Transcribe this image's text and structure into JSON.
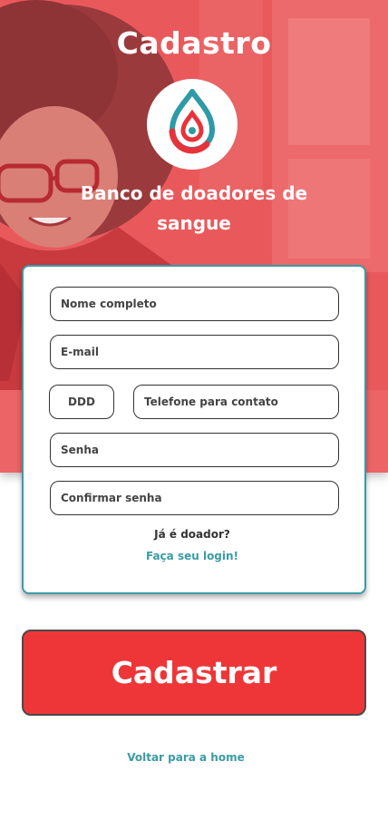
{
  "header": {
    "title": "Cadastro",
    "subtitle": "Banco de doadores de sangue",
    "logo_icon": "blood-drop-icon"
  },
  "form": {
    "full_name_placeholder": "Nome completo",
    "email_placeholder": "E-mail",
    "ddd_placeholder": "DDD",
    "phone_placeholder": "Telefone para contato",
    "password_placeholder": "Senha",
    "confirm_password_placeholder": "Confirmar senha",
    "already_donor_text": "Já é doador?",
    "login_link": "Faça seu login!"
  },
  "actions": {
    "submit_label": "Cadastrar",
    "back_link": "Voltar para a home"
  },
  "colors": {
    "hero_overlay": "#e7595d",
    "accent_teal": "#3b9ba6",
    "primary_red": "#ee3638"
  }
}
